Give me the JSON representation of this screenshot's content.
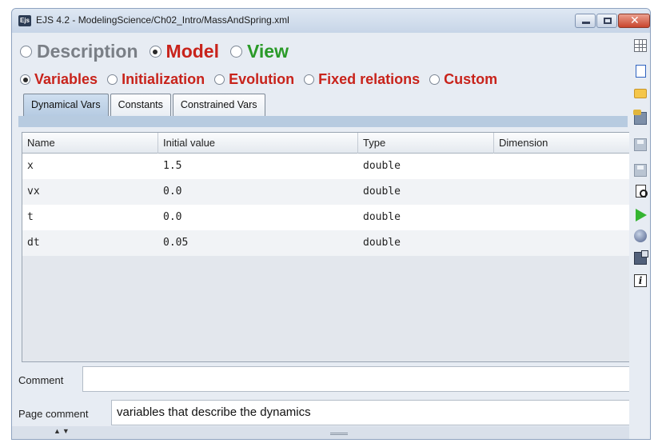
{
  "window": {
    "title": "EJS 4.2 - ModelingScience/Ch02_Intro/MassAndSpring.xml",
    "app_icon_text": "Ejs"
  },
  "main_tabs": [
    {
      "label": "Description",
      "checked": false,
      "color": "#7a7f86"
    },
    {
      "label": "Model",
      "checked": true,
      "color": "#c8231b"
    },
    {
      "label": "View",
      "checked": false,
      "color": "#2a9a28"
    }
  ],
  "model_sections": [
    {
      "label": "Variables",
      "checked": true
    },
    {
      "label": "Initialization",
      "checked": false
    },
    {
      "label": "Evolution",
      "checked": false
    },
    {
      "label": "Fixed relations",
      "checked": false
    },
    {
      "label": "Custom",
      "checked": false
    }
  ],
  "var_tabs": [
    {
      "label": "Dynamical Vars",
      "active": true
    },
    {
      "label": "Constants",
      "active": false
    },
    {
      "label": "Constrained Vars",
      "active": false
    }
  ],
  "table": {
    "columns": [
      "Name",
      "Initial value",
      "Type",
      "Dimension"
    ],
    "rows": [
      {
        "name": "x",
        "value": "1.5",
        "type": "double",
        "dimension": ""
      },
      {
        "name": "vx",
        "value": "0.0",
        "type": "double",
        "dimension": ""
      },
      {
        "name": "t",
        "value": "0.0",
        "type": "double",
        "dimension": ""
      },
      {
        "name": "dt",
        "value": "0.05",
        "type": "double",
        "dimension": ""
      }
    ]
  },
  "comment": {
    "label": "Comment",
    "value": ""
  },
  "page_comment": {
    "label": "Page comment",
    "value": "variables that describe the dynamics"
  },
  "bottom_bar": {
    "arrows": "▲▼"
  },
  "window_controls": {
    "close_glyph": "✕"
  },
  "toolbar_icons": [
    "grid-icon",
    "new-document-icon",
    "open-folder-icon",
    "save-as-icon",
    "save-icon",
    "save-disk-icon",
    "preview-icon",
    "run-icon",
    "globe-icon",
    "options-icon",
    "info-icon"
  ],
  "toolbar_info_glyph": "i"
}
